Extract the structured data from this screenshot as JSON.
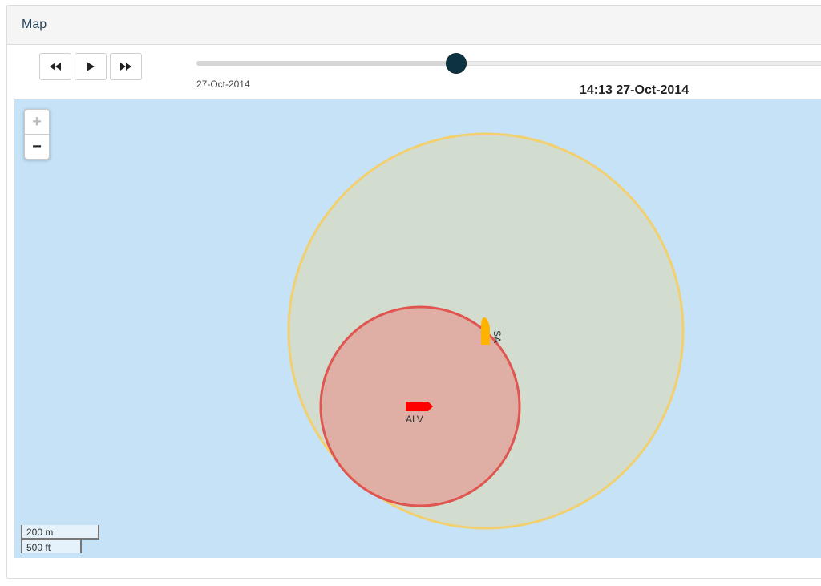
{
  "panel": {
    "title": "Map"
  },
  "playback": {
    "buttons": [
      {
        "name": "rewind-button",
        "icon": "rewind-icon"
      },
      {
        "name": "play-button",
        "icon": "play-icon"
      },
      {
        "name": "fast-forward-button",
        "icon": "fast-forward-icon"
      }
    ],
    "slider_position": 0.41,
    "start_date": "27-Oct-2014",
    "current_time": "14:13 27-Oct-2014"
  },
  "map": {
    "zoom_in": "+",
    "zoom_out": "−",
    "vessels": [
      {
        "label": "ALV",
        "color": "#ff0000",
        "zone_fill": "#e0a9a0",
        "zone_stroke": "#e05550"
      },
      {
        "label": "SA",
        "color": "#ffb300",
        "zone_fill": "#d3dcc8",
        "zone_stroke": "#f3cf6e"
      }
    ],
    "scale": {
      "metric": "200 m",
      "imperial": "500 ft"
    },
    "colors": {
      "water": "#c5e2f7"
    }
  }
}
